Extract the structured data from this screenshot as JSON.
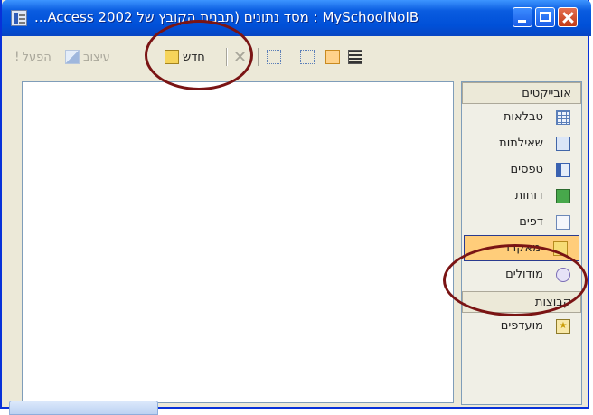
{
  "window": {
    "title": "MySchoolNoIB : מסד נתונים (תבנית הקובץ של Access 2002..."
  },
  "toolbar": {
    "run_label": "הפעל",
    "design_label": "עיצוב",
    "new_label": "חדש"
  },
  "object_bar": {
    "header": "אובייקטים",
    "items": [
      {
        "label": "טבלאות",
        "icon": "table-icon"
      },
      {
        "label": "שאילתות",
        "icon": "query-icon"
      },
      {
        "label": "טפסים",
        "icon": "form-icon"
      },
      {
        "label": "דוחות",
        "icon": "report-icon"
      },
      {
        "label": "דפים",
        "icon": "page-icon"
      },
      {
        "label": "מאקרו",
        "icon": "macro-icon"
      },
      {
        "label": "מודולים",
        "icon": "module-icon"
      }
    ],
    "selected": "מאקרו",
    "groups_header": "קבוצות",
    "groups": [
      {
        "label": "מועדפים",
        "icon": "favorites-icon"
      }
    ]
  },
  "colors": {
    "titlebar": "#0a5ce0",
    "selected_item": "#ffcd7a",
    "annotation_circle": "#7a1414"
  }
}
